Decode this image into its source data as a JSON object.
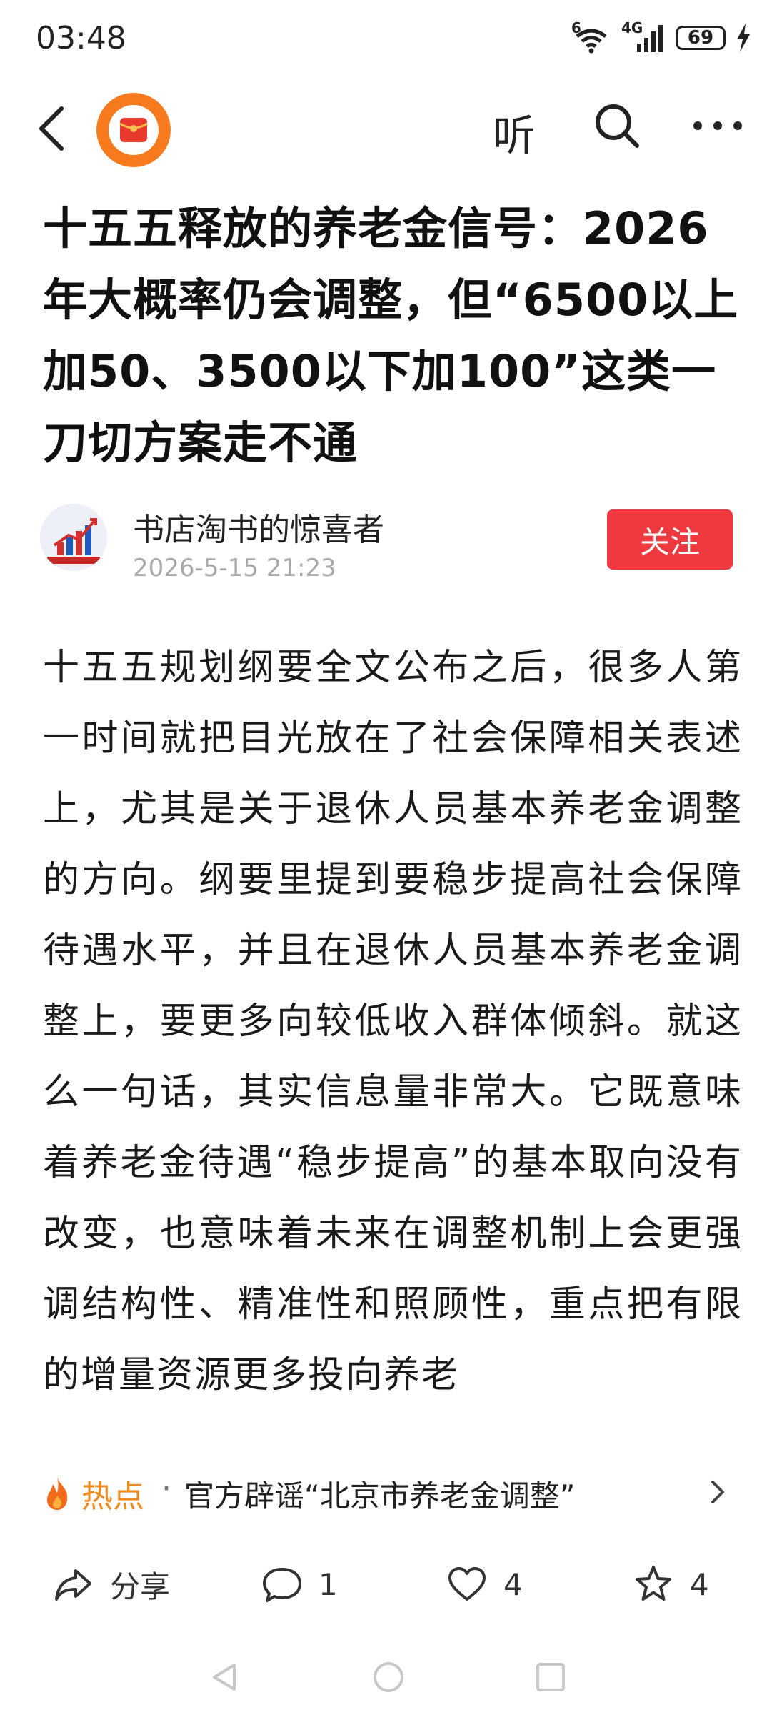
{
  "status_bar": {
    "time": "03:48",
    "network": "6",
    "mobile": "4G",
    "battery": "69",
    "icons": [
      "wifi-icon",
      "signal-icon",
      "battery-icon",
      "charging-icon"
    ]
  },
  "nav": {
    "back_icon": "back-arrow-icon",
    "logo_icon": "red-envelope-icon",
    "listen_label": "听",
    "search_icon": "search-icon",
    "more_icon": "more-icon"
  },
  "article": {
    "title": "十五五释放的养老金信号：2026年大概率仍会调整，但“6500以上加50、3500以下加100”这类一刀切方案走不通",
    "author": {
      "name": "书店淘书的惊喜者",
      "time": "2026-5-15 21:23",
      "follow_label": "关注"
    },
    "body": "十五五规划纲要全文公布之后，很多人第一时间就把目光放在了社会保障相关表述上，尤其是关于退休人员基本养老金调整的方向。纲要里提到要稳步提高社会保障待遇水平，并且在退休人员基本养老金调整上，要更多向较低收入群体倾斜。就这么一句话，其实信息量非常大。它既意味着养老金待遇“稳步提高”的基本取向没有改变，也意味着未来在调整机制上会更强调结构性、精准性和照顾性，重点把有限的增量资源更多投向养老"
  },
  "hot": {
    "label": "热点",
    "separator": "·",
    "text": "官方辟谣“北京市养老金调整”"
  },
  "actions": {
    "share_label": "分享",
    "comment_count": "1",
    "like_count": "4",
    "favorite_count": "4"
  },
  "colors": {
    "accent_red": "#f0393e",
    "hot_orange": "#f08a1c",
    "logo_orange": "#f77b1e"
  }
}
